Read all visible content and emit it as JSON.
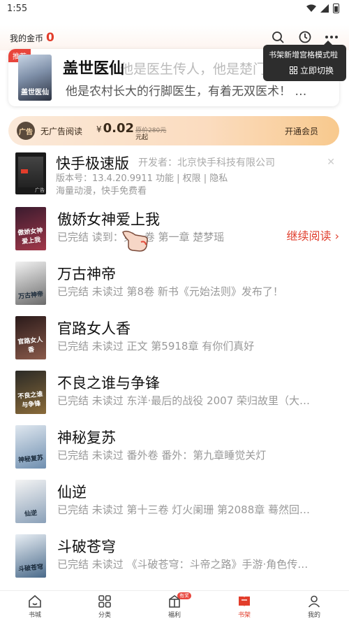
{
  "status": {
    "time": "1:55"
  },
  "header": {
    "coins_label": "我的金币",
    "coins_value": "0",
    "tooltip_line1": "书架新增宫格模式啦",
    "tooltip_line2": "立即切换"
  },
  "recommend": {
    "tag": "推荐",
    "cover_text": "盖世医仙",
    "title": "盖世医仙",
    "desc1": "他是医生传人，他是楚门之主！",
    "desc2": "他是农村长大的行脚医生，有着无双医术！ …"
  },
  "vip": {
    "icon_text": "广告",
    "label": "无广告阅读",
    "currency": "¥",
    "price": "0.02",
    "orig_price": "原价280元",
    "unit": "元起",
    "button": "开通会员"
  },
  "ad": {
    "title": "快手极速版",
    "developer": "开发者：北京快手科技有限公司",
    "meta": "版本号：13.4.20.9911   功能 | 权限 | 隐私",
    "slogan": "海量动漫，快手免费看",
    "cover_label": "广告",
    "close": "✕"
  },
  "books": [
    {
      "title": "傲娇女神爱上我",
      "cover_text": "傲娇女神爱上我",
      "status": "已完结 读到：第一卷 第一章 楚梦瑶",
      "continue": "继续阅读 ›",
      "colors": [
        "#3a1b2e",
        "#a2384a"
      ]
    },
    {
      "title": "万古神帝",
      "cover_text": "万古神帝",
      "status": "已完结 未读过 第8卷 新书《元始法则》发布了！",
      "colors": [
        "#f2f2f2",
        "#6b6b6b"
      ]
    },
    {
      "title": "官路女人香",
      "cover_text": "官路女人香",
      "status": "已完结 未读过 正文 第5918章 有你们真好",
      "colors": [
        "#2a1a1a",
        "#8a5a4a"
      ]
    },
    {
      "title": "不良之谁与争锋",
      "cover_text": "不良之谁与争锋",
      "status": "已完结 未读过 东洋·最后的战役 2007  荣归故里（大…",
      "colors": [
        "#2b2a26",
        "#8a6b3a"
      ]
    },
    {
      "title": "神秘复苏",
      "cover_text": "神秘复苏",
      "status": "已完结 未读过 番外卷 番外：第九章睡觉关灯",
      "colors": [
        "#dfe7ef",
        "#6f8fb0"
      ]
    },
    {
      "title": "仙逆",
      "cover_text": "仙逆",
      "status": "已完结 未读过 第十三卷 灯火阑珊 第2088章 蓦然回…",
      "colors": [
        "#f4f4f4",
        "#8aa0b8"
      ]
    },
    {
      "title": "斗破苍穹",
      "cover_text": "斗破苍穹",
      "status": "已完结 未读过 《斗破苍穹：斗帝之路》手游·角色传…",
      "colors": [
        "#e8eef4",
        "#4a6a8a"
      ]
    }
  ],
  "nav": [
    {
      "label": "书城",
      "icon": "home-icon"
    },
    {
      "label": "分类",
      "icon": "category-icon"
    },
    {
      "label": "福利",
      "icon": "gift-icon",
      "badge": "有奖"
    },
    {
      "label": "书架",
      "icon": "bookshelf-icon",
      "active": true
    },
    {
      "label": "我的",
      "icon": "profile-icon"
    }
  ],
  "colors": {
    "accent": "#e23d2b",
    "continue": "#e0402f"
  }
}
